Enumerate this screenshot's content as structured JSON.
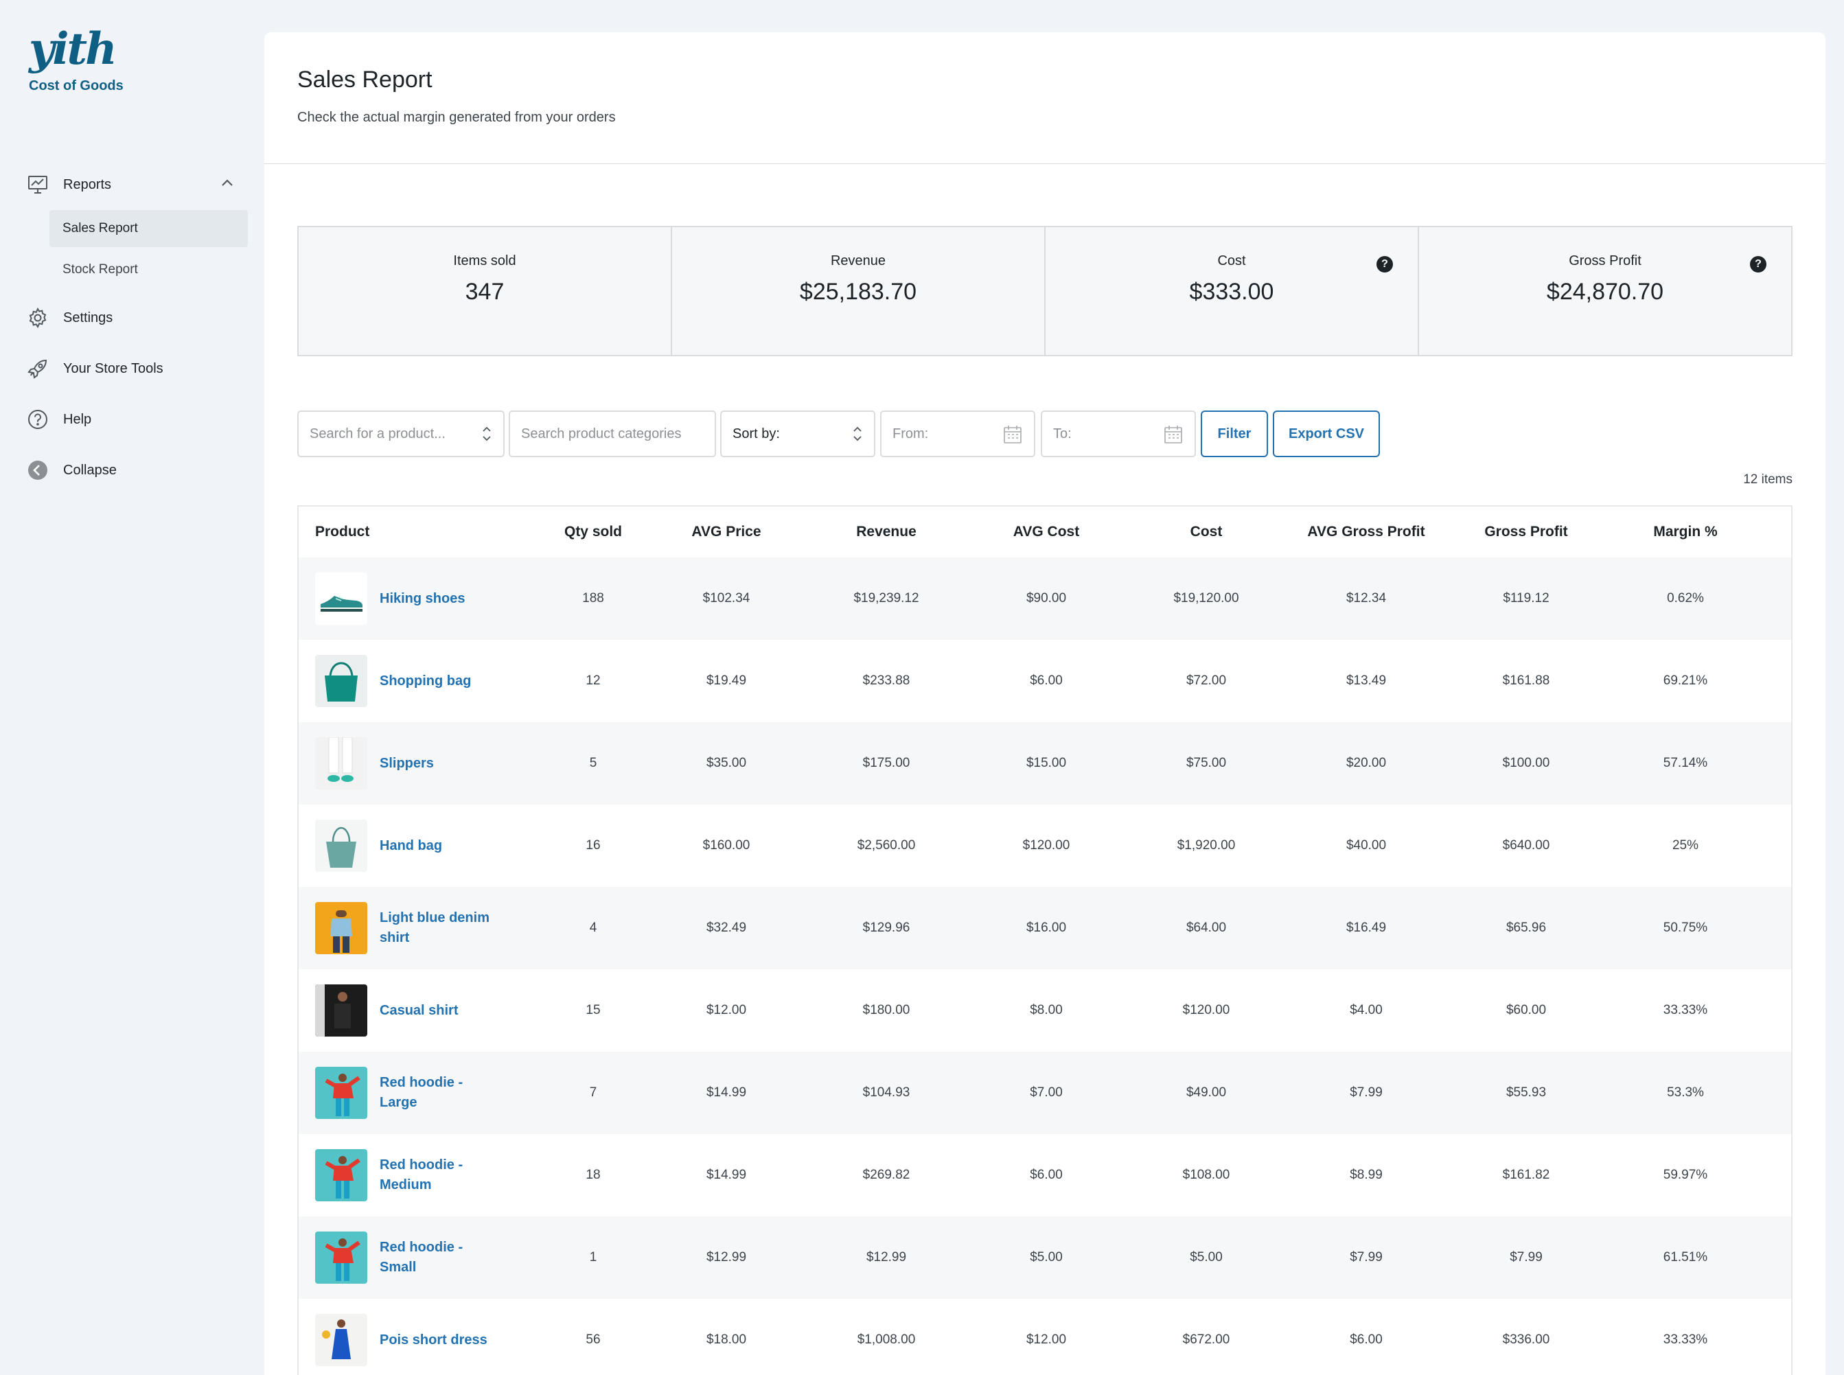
{
  "brand": {
    "logo_text": "yith",
    "subtitle": "Cost of Goods",
    "color": "#0f5f85"
  },
  "nav": {
    "reports": "Reports",
    "sales_report": "Sales Report",
    "stock_report": "Stock Report",
    "settings": "Settings",
    "store_tools": "Your Store Tools",
    "help": "Help",
    "collapse": "Collapse"
  },
  "page": {
    "title": "Sales Report",
    "subtitle": "Check the actual margin generated from your orders"
  },
  "stats": [
    {
      "label": "Items sold",
      "value": "347"
    },
    {
      "label": "Revenue",
      "value": "$25,183.70"
    },
    {
      "label": "Cost",
      "value": "$333.00"
    },
    {
      "label": "Gross Profit",
      "value": "$24,870.70"
    }
  ],
  "filters": {
    "product_placeholder": "Search for a product...",
    "category_placeholder": "Search product categories",
    "sort_label": "Sort by:",
    "from_placeholder": "From:",
    "to_placeholder": "To:",
    "filter_button": "Filter",
    "export_button": "Export CSV"
  },
  "items_count": "12 items",
  "table": {
    "columns": [
      "Product",
      "Qty sold",
      "AVG Price",
      "Revenue",
      "AVG Cost",
      "Cost",
      "AVG Gross Profit",
      "Gross Profit",
      "Margin %"
    ],
    "rows": [
      {
        "product": "Hiking shoes",
        "thumb": "shoe",
        "qty": "188",
        "avg_price": "$102.34",
        "revenue": "$19,239.12",
        "avg_cost": "$90.00",
        "cost": "$19,120.00",
        "avg_gp": "$12.34",
        "gp": "$119.12",
        "margin": "0.62%"
      },
      {
        "product": "Shopping bag",
        "thumb": "bag-teal",
        "qty": "12",
        "avg_price": "$19.49",
        "revenue": "$233.88",
        "avg_cost": "$6.00",
        "cost": "$72.00",
        "avg_gp": "$13.49",
        "gp": "$161.88",
        "margin": "69.21%"
      },
      {
        "product": "Slippers",
        "thumb": "slippers",
        "qty": "5",
        "avg_price": "$35.00",
        "revenue": "$175.00",
        "avg_cost": "$15.00",
        "cost": "$75.00",
        "avg_gp": "$20.00",
        "gp": "$100.00",
        "margin": "57.14%"
      },
      {
        "product": "Hand bag",
        "thumb": "handbag",
        "qty": "16",
        "avg_price": "$160.00",
        "revenue": "$2,560.00",
        "avg_cost": "$120.00",
        "cost": "$1,920.00",
        "avg_gp": "$40.00",
        "gp": "$640.00",
        "margin": "25%"
      },
      {
        "product": "Light blue denim shirt",
        "thumb": "denim",
        "qty": "4",
        "avg_price": "$32.49",
        "revenue": "$129.96",
        "avg_cost": "$16.00",
        "cost": "$64.00",
        "avg_gp": "$16.49",
        "gp": "$65.96",
        "margin": "50.75%"
      },
      {
        "product": "Casual shirt",
        "thumb": "casual",
        "qty": "15",
        "avg_price": "$12.00",
        "revenue": "$180.00",
        "avg_cost": "$8.00",
        "cost": "$120.00",
        "avg_gp": "$4.00",
        "gp": "$60.00",
        "margin": "33.33%"
      },
      {
        "product": "Red hoodie - Large",
        "thumb": "hoodie",
        "qty": "7",
        "avg_price": "$14.99",
        "revenue": "$104.93",
        "avg_cost": "$7.00",
        "cost": "$49.00",
        "avg_gp": "$7.99",
        "gp": "$55.93",
        "margin": "53.3%"
      },
      {
        "product": "Red hoodie - Medium",
        "thumb": "hoodie",
        "qty": "18",
        "avg_price": "$14.99",
        "revenue": "$269.82",
        "avg_cost": "$6.00",
        "cost": "$108.00",
        "avg_gp": "$8.99",
        "gp": "$161.82",
        "margin": "59.97%"
      },
      {
        "product": "Red hoodie - Small",
        "thumb": "hoodie",
        "qty": "1",
        "avg_price": "$12.99",
        "revenue": "$12.99",
        "avg_cost": "$5.00",
        "cost": "$5.00",
        "avg_gp": "$7.99",
        "gp": "$7.99",
        "margin": "61.51%"
      },
      {
        "product": "Pois short dress",
        "thumb": "dress",
        "qty": "56",
        "avg_price": "$18.00",
        "revenue": "$1,008.00",
        "avg_cost": "$12.00",
        "cost": "$672.00",
        "avg_gp": "$6.00",
        "gp": "$336.00",
        "margin": "33.33%"
      }
    ]
  }
}
